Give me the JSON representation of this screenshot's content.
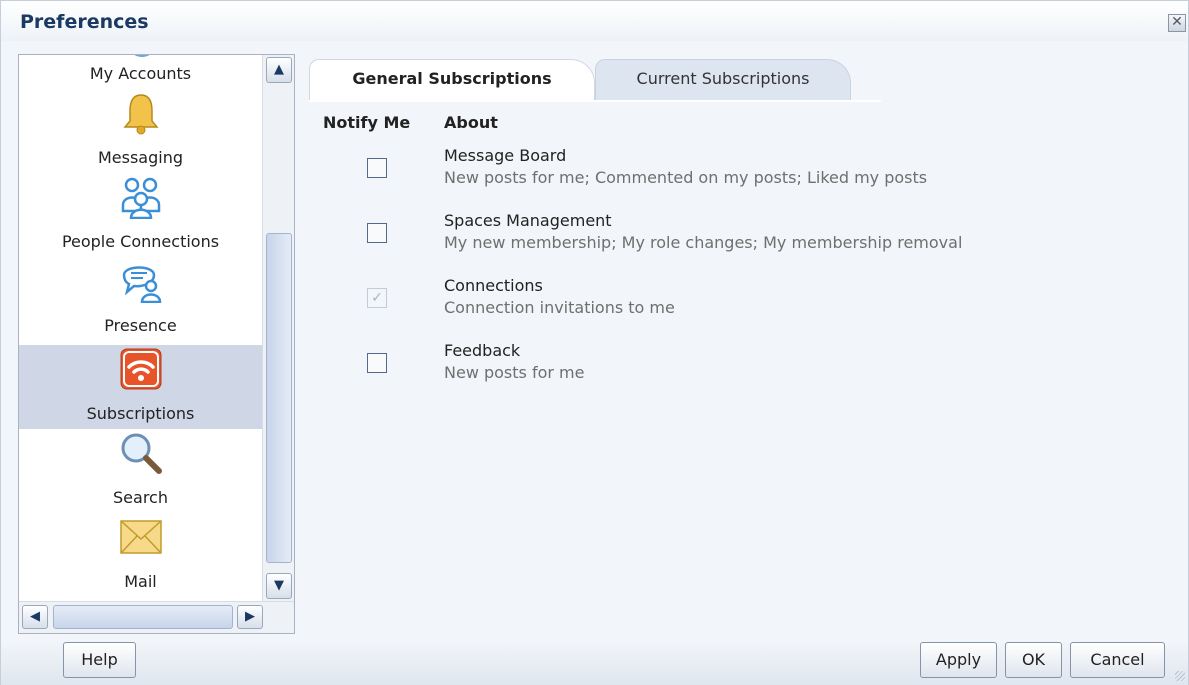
{
  "dialog": {
    "title": "Preferences"
  },
  "sidebar": {
    "items": [
      {
        "label": "My Accounts",
        "icon": "accounts-icon"
      },
      {
        "label": "Messaging",
        "icon": "bell-icon"
      },
      {
        "label": "People Connections",
        "icon": "people-icon"
      },
      {
        "label": "Presence",
        "icon": "presence-icon"
      },
      {
        "label": "Subscriptions",
        "icon": "rss-icon",
        "selected": true
      },
      {
        "label": "Search",
        "icon": "magnifier-icon"
      },
      {
        "label": "Mail",
        "icon": "envelope-icon"
      }
    ]
  },
  "tabs": [
    {
      "label": "General Subscriptions",
      "active": true
    },
    {
      "label": "Current Subscriptions",
      "active": false
    }
  ],
  "table": {
    "headers": {
      "notify": "Notify Me",
      "about": "About"
    },
    "rows": [
      {
        "title": "Message Board",
        "desc": "New posts for me; Commented on my posts; Liked my posts",
        "checked": false,
        "disabled": false
      },
      {
        "title": "Spaces Management",
        "desc": "My new membership; My role changes; My membership removal",
        "checked": false,
        "disabled": false
      },
      {
        "title": "Connections",
        "desc": "Connection invitations to me",
        "checked": true,
        "disabled": true
      },
      {
        "title": "Feedback",
        "desc": "New posts for me",
        "checked": false,
        "disabled": false
      }
    ]
  },
  "footer": {
    "help": "Help",
    "apply": "Apply",
    "ok": "OK",
    "cancel": "Cancel"
  },
  "colors": {
    "title": "#1b3a63",
    "selected_bg": "#cfd7e6",
    "rss_orange": "#e8542a",
    "people_blue": "#3b8fd6"
  }
}
